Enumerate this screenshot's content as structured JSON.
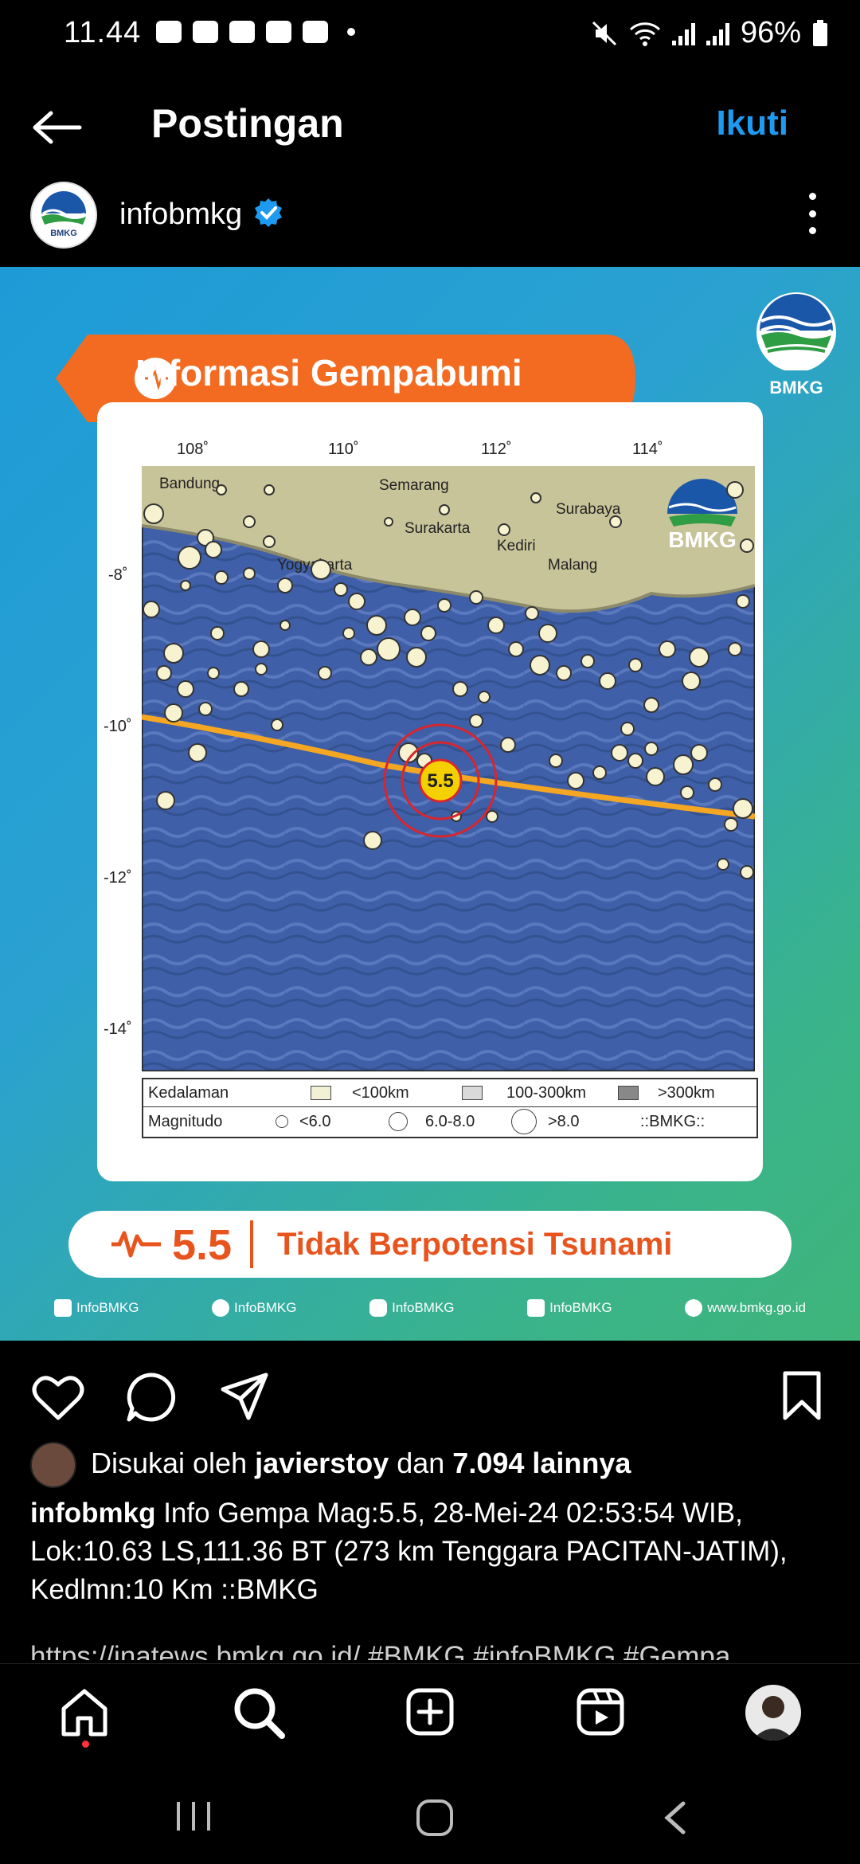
{
  "status_bar": {
    "time": "11.44",
    "battery": "96%"
  },
  "header": {
    "title": "Postingan",
    "follow_label": "Ikuti"
  },
  "profile": {
    "username": "infobmkg",
    "avatar_text": "BMKG"
  },
  "post_image": {
    "banner_title": "Informasi Gempabumi",
    "logo_text": "BMKG",
    "map_logo_text": "BMKG",
    "x_ticks": [
      "108˚",
      "110˚",
      "112˚",
      "114˚"
    ],
    "y_ticks": [
      "-8˚",
      "-10˚",
      "-12˚",
      "-14˚"
    ],
    "places": [
      "Bandung",
      "Semarang",
      "Surakarta",
      "Surabaya",
      "Yogyakarta",
      "Kediri",
      "Malang"
    ],
    "epicenter_magnitude": "5.5",
    "legend": {
      "depth_label": "Kedalaman",
      "depth_items": [
        "<100km",
        "100-300km",
        ">300km"
      ],
      "magnitude_label": "Magnitudo",
      "magnitude_items": [
        "<6.0",
        "6.0-8.0",
        ">8.0"
      ],
      "credit": "::BMKG::"
    },
    "magnitude": "5.5",
    "tsunami_status": "Tidak Berpotensi Tsunami",
    "socials": [
      "InfoBMKG",
      "InfoBMKG",
      "InfoBMKG",
      "InfoBMKG",
      "www.bmkg.go.id"
    ]
  },
  "likes": {
    "prefix": "Disukai oleh ",
    "user": "javierstoy",
    "middle": " dan ",
    "count": "7.094 lainnya"
  },
  "caption": {
    "username": "infobmkg",
    "text": " Info Gempa Mag:5.5, 28-Mei-24 02:53:54 WIB, Lok:10.63 LS,111.36 BT (273 km Tenggara PACITAN-JATIM), Kedlmn:10 Km ::BMKG",
    "link_line": "https://inatews.bmkg.go.id/ #BMKG #infoBMKG #Gempa"
  },
  "colors": {
    "accent": "#1e9bf0",
    "orange": "#e8541e",
    "sea": "#3f5fa8",
    "land": "#c8c49a"
  }
}
